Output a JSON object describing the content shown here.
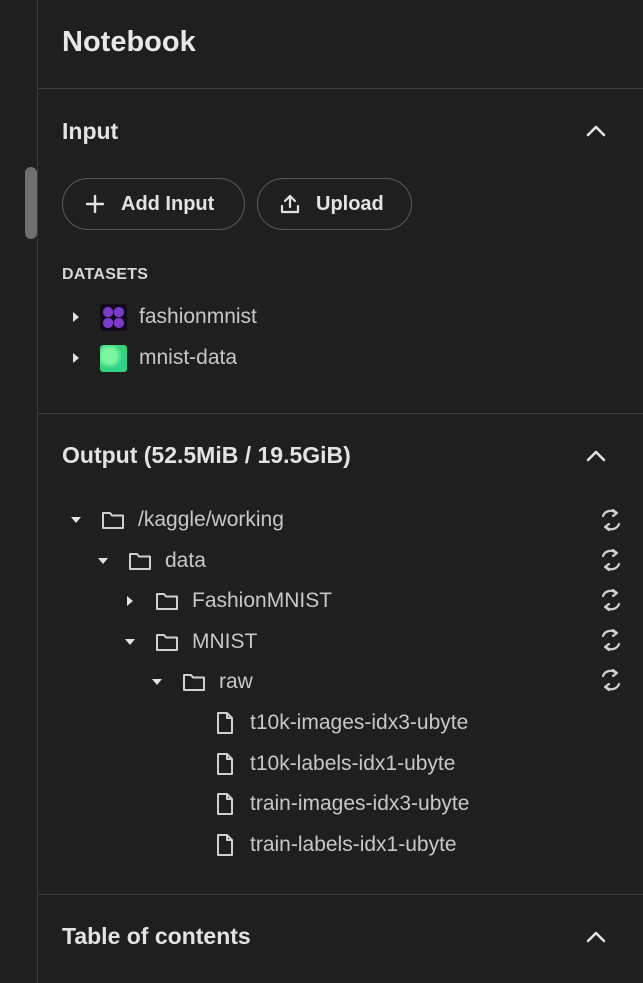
{
  "notebook": {
    "title": "Notebook"
  },
  "input_section": {
    "title": "Input",
    "add_input_label": "Add Input",
    "upload_label": "Upload",
    "datasets_heading": "DATASETS",
    "datasets": [
      {
        "name": "fashionmnist",
        "icon": "fashionmnist-thumbnail"
      },
      {
        "name": "mnist-data",
        "icon": "mnist-data-thumbnail"
      }
    ]
  },
  "output_section": {
    "title": "Output (52.5MiB / 19.5GiB)",
    "tree": [
      {
        "name": "/kaggle/working",
        "type": "folder",
        "expanded": true
      },
      {
        "name": "data",
        "type": "folder",
        "expanded": true
      },
      {
        "name": "FashionMNIST",
        "type": "folder",
        "expanded": false
      },
      {
        "name": "MNIST",
        "type": "folder",
        "expanded": true
      },
      {
        "name": "raw",
        "type": "folder",
        "expanded": true
      },
      {
        "name": "t10k-images-idx3-ubyte",
        "type": "file"
      },
      {
        "name": "t10k-labels-idx1-ubyte",
        "type": "file"
      },
      {
        "name": "train-images-idx3-ubyte",
        "type": "file"
      },
      {
        "name": "train-labels-idx1-ubyte",
        "type": "file"
      }
    ]
  },
  "toc_section": {
    "title": "Table of contents"
  },
  "colors": {
    "background": "#1f1f1f",
    "divider": "#3c3c3c",
    "text": "#e3e3e3",
    "muted_text": "#c8c8c8"
  }
}
